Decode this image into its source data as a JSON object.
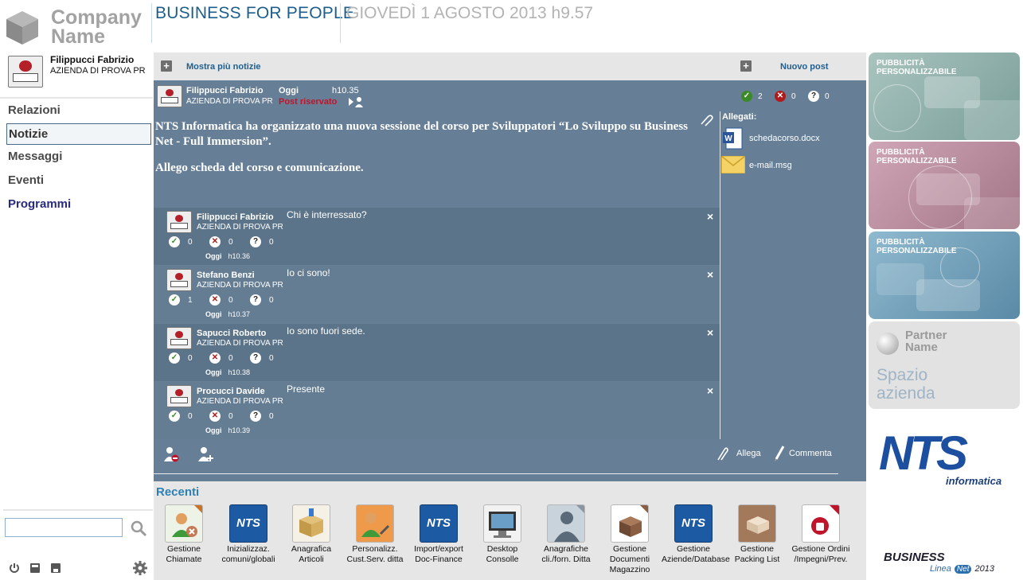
{
  "header": {
    "company_line1": "Company",
    "company_line2": "Name",
    "app_title": "BUSINESS FOR PEOPLE",
    "datetime": "GIOVEDÌ 1 AGOSTO 2013 h9.57"
  },
  "user": {
    "name": "Filippucci Fabrizio",
    "company": "AZIENDA DI PROVA PR",
    "avatar_caption": "Name"
  },
  "sidebar": {
    "items": [
      {
        "label": "Relazioni"
      },
      {
        "label": "Notizie"
      },
      {
        "label": "Messaggi"
      },
      {
        "label": "Eventi"
      },
      {
        "label": "Programmi"
      }
    ],
    "active": "Notizie",
    "search_value": ""
  },
  "toolbar": {
    "more_news": "Mostra più notizie",
    "new_post": "Nuovo post"
  },
  "post": {
    "author": "Filippucci Fabrizio",
    "company": "AZIENDA DI PROVA PR",
    "day": "Oggi",
    "time": "h10.35",
    "visibility": "Post riservato",
    "votes": {
      "yes": "2",
      "no": "0",
      "maybe": "0"
    },
    "body_line1": "NTS Informatica ha organizzato una nuova sessione del corso per Sviluppatori “Lo Sviluppo su Business Net - Full Immersion”.",
    "body_line2": "Allego scheda del corso e comunicazione.",
    "attachments_label": "Allegati:",
    "attachments": [
      "schedacorso.docx",
      "e-mail.msg"
    ],
    "attach_action": "Allega",
    "comment_action": "Commenta"
  },
  "comments": [
    {
      "author": "Filippucci Fabrizio",
      "company": "AZIENDA DI PROVA PR",
      "text": "Chi è interressato?",
      "yes": "0",
      "no": "0",
      "maybe": "0",
      "day": "Oggi",
      "time": "h10.36"
    },
    {
      "author": "Stefano Benzi",
      "company": "AZIENDA DI PROVA PR",
      "text": "Io ci sono!",
      "yes": "1",
      "no": "0",
      "maybe": "0",
      "day": "Oggi",
      "time": "h10.37"
    },
    {
      "author": "Sapucci Roberto",
      "company": "AZIENDA DI PROVA PR",
      "text": "Io sono fuori sede.",
      "yes": "0",
      "no": "0",
      "maybe": "0",
      "day": "Oggi",
      "time": "h10.38"
    },
    {
      "author": "Procucci Davide",
      "company": "AZIENDA DI PROVA PR",
      "text": "Presente",
      "yes": "0",
      "no": "0",
      "maybe": "0",
      "day": "Oggi",
      "time": "h10.39"
    }
  ],
  "banners": [
    {
      "label": "PUBBLICITÀ PERSONALIZZABILE",
      "color": "#8fb0ab"
    },
    {
      "label": "PUBBLICITÀ PERSONALIZZABILE",
      "color": "#b98b9c"
    },
    {
      "label": "PUBBLICITÀ PERSONALIZZABILE",
      "color": "#6f9fb8"
    }
  ],
  "partner": {
    "name_line1": "Partner",
    "name_line2": "Name",
    "space_line1": "Spazio",
    "space_line2": "azienda"
  },
  "brand": {
    "nts": "NTS",
    "informatica": "informatica",
    "business": "BUSINESS",
    "linea": "Linea",
    "net": "Net",
    "year": "2013"
  },
  "recenti": {
    "title": "Recenti",
    "apps": [
      {
        "label": "Gestione Chiamate",
        "icon": "people-icon"
      },
      {
        "label": "Inizializzaz. comuni/globali",
        "icon": "nts-icon"
      },
      {
        "label": "Anagrafica Articoli",
        "icon": "box-icon"
      },
      {
        "label": "Personalizz. Cust.Serv. ditta",
        "icon": "people-tools-icon"
      },
      {
        "label": "Import/export Doc-Finance",
        "icon": "nts-icon"
      },
      {
        "label": "Desktop Consolle",
        "icon": "monitor-icon"
      },
      {
        "label": "Anagrafiche cli./forn. Ditta",
        "icon": "person-silhouette-icon"
      },
      {
        "label": "Gestione Documenti Magazzino",
        "icon": "document-box-icon"
      },
      {
        "label": "Gestione Aziende/Database",
        "icon": "nts-icon"
      },
      {
        "label": "Gestione Packing List",
        "icon": "packing-icon"
      },
      {
        "label": "Gestione Ordini /Impegni/Prev.",
        "icon": "order-document-icon"
      }
    ]
  },
  "colors": {
    "brand_blue": "#1d5e8c",
    "post_background": "#677f96",
    "reserved_red": "#c0142a",
    "nts_blue": "#1c5aa3"
  }
}
